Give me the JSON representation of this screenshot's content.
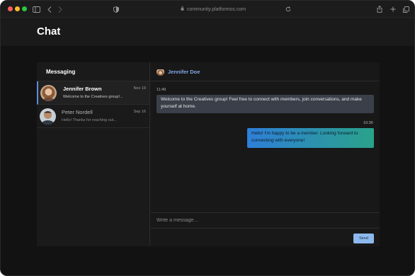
{
  "browser": {
    "url": "community.platformos.com"
  },
  "page": {
    "title": "Chat"
  },
  "sidebar": {
    "title": "Messaging",
    "conversations": [
      {
        "name": "Jennifer Brown",
        "date": "Nov 19",
        "preview": "Welcome to the Creatives group!...",
        "active": true
      },
      {
        "name": "Peter Nordell",
        "date": "Sep 16",
        "preview": "Hello! Thanks for reaching out...",
        "active": false
      }
    ]
  },
  "thread": {
    "contact_name": "Jennifer Doe",
    "messages": [
      {
        "direction": "incoming",
        "time": "11:49",
        "text": "Welcome to the Creatives group! Feel free to connect with members, join conversations, and make yourself at home."
      },
      {
        "direction": "outgoing",
        "time": "10:36",
        "text": "Hello! I'm happy to be a member. Looking forward to connecting with everyone!"
      }
    ]
  },
  "composer": {
    "placeholder": "Write a message...",
    "value": "",
    "send_label": "Send"
  },
  "colors": {
    "accent": "#7fa7e8",
    "active_border": "#5b8dd6",
    "send_button": "#8cb8ee",
    "incoming_bubble": "#3a3f4a",
    "outgoing_gradient_start": "#2e7fd8",
    "outgoing_gradient_end": "#2aa28a"
  }
}
